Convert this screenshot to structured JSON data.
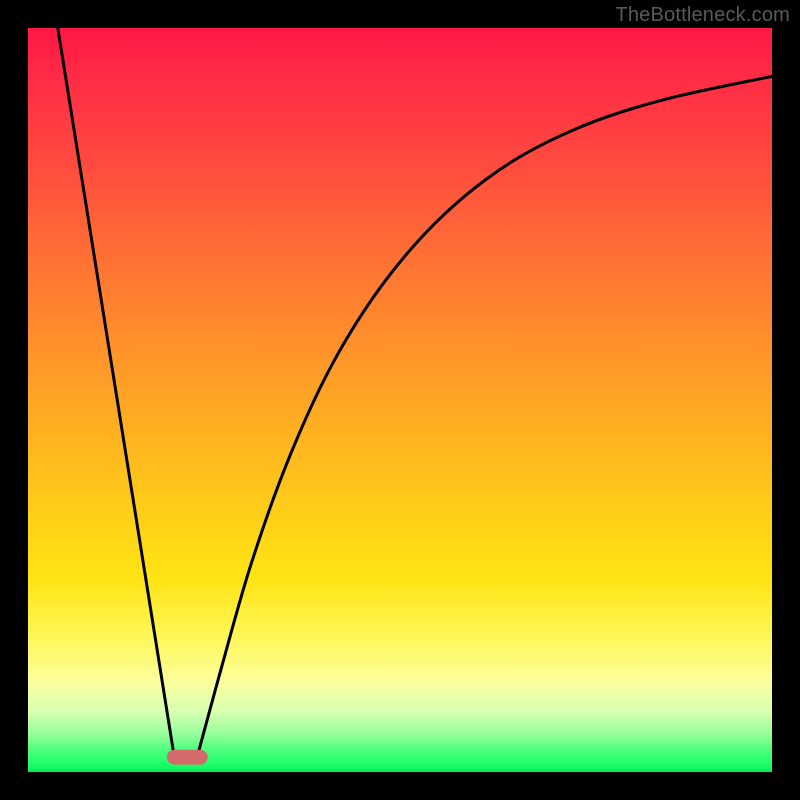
{
  "watermark": "TheBottleneck.com",
  "chart_data": {
    "type": "line",
    "title": "",
    "xlabel": "",
    "ylabel": "",
    "xlim": [
      0,
      1
    ],
    "ylim": [
      0,
      1
    ],
    "series": [
      {
        "name": "left-linear-descent",
        "x": [
          0.04,
          0.195
        ],
        "y": [
          1.0,
          0.03
        ]
      },
      {
        "name": "right-curve-ascent",
        "x": [
          0.23,
          0.26,
          0.3,
          0.35,
          0.41,
          0.48,
          0.56,
          0.65,
          0.75,
          0.86,
          1.0
        ],
        "y": [
          0.03,
          0.14,
          0.28,
          0.42,
          0.55,
          0.66,
          0.75,
          0.82,
          0.87,
          0.905,
          0.935
        ]
      }
    ],
    "marker": {
      "name": "bottom-pill",
      "x_center": 0.214,
      "y": 0.02,
      "width": 0.055,
      "height": 0.02,
      "color": "#d46a6a"
    },
    "background_gradient": {
      "stops": [
        {
          "pos": 0.0,
          "color": "#ff1744"
        },
        {
          "pos": 0.34,
          "color": "#ff7a32"
        },
        {
          "pos": 0.62,
          "color": "#ffc61a"
        },
        {
          "pos": 0.88,
          "color": "#fbff9d"
        },
        {
          "pos": 1.0,
          "color": "#07e85a"
        }
      ]
    }
  }
}
